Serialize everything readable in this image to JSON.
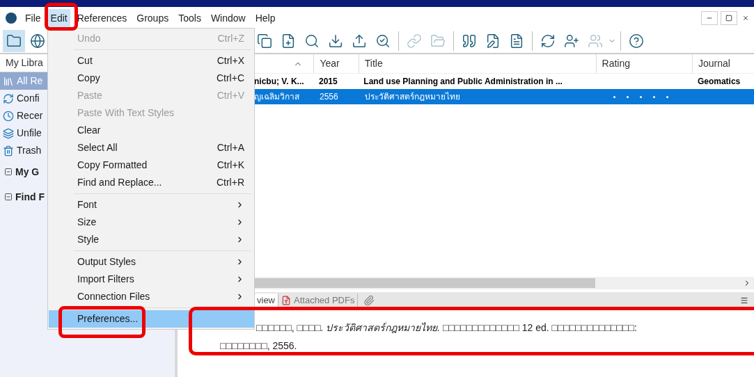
{
  "menu_bar": [
    {
      "label": "File",
      "selected": false
    },
    {
      "label": "Edit",
      "selected": true
    },
    {
      "label": "References",
      "selected": false
    },
    {
      "label": "Groups",
      "selected": false
    },
    {
      "label": "Tools",
      "selected": false
    },
    {
      "label": "Window",
      "selected": false
    },
    {
      "label": "Help",
      "selected": false
    }
  ],
  "sidebar": {
    "header": "My Libra",
    "items": [
      {
        "label": "All Re",
        "selected": true
      },
      {
        "label": "Confi",
        "selected": false
      },
      {
        "label": "Recer",
        "selected": false
      },
      {
        "label": "Unfile",
        "selected": false
      },
      {
        "label": "Trash",
        "selected": false
      }
    ],
    "groups": [
      {
        "label": "My G",
        "expanded": true
      },
      {
        "label": "Find F",
        "expanded": true
      }
    ]
  },
  "table": {
    "columns": [
      "Year",
      "Title",
      "Rating",
      "Journal"
    ],
    "rows": [
      {
        "author": "nicbu; V. K...",
        "year": "2015",
        "title": "Land use Planning and Public Administration in ...",
        "journal": "Geomatics",
        "selected": false,
        "unread": true
      },
      {
        "author": "ญเฉลิมวิกาส",
        "year": "2556",
        "title": "ประวัติศาสตร์กฎหมายไทย",
        "journal": "",
        "selected": true,
        "unread": false
      }
    ]
  },
  "preview": {
    "tabs": [
      {
        "label": "view",
        "selected": true
      },
      {
        "label": "Attached PDFs",
        "selected": false
      }
    ],
    "text": "□□□□□□, □□□□. *ประวัติศาสตร์กฎหมายไทย.* □□□□□□□□□□□□□ 12 ed. □□□□□□□□□□□□□□:",
    "text_line2": "□□□□□□□□, 2556."
  },
  "edit_menu": [
    {
      "kind": "item",
      "label": "Undo",
      "shortcut": "Ctrl+Z",
      "disabled": true,
      "selected": false
    },
    {
      "kind": "separator"
    },
    {
      "kind": "item",
      "label": "Cut",
      "shortcut": "Ctrl+X",
      "disabled": false,
      "selected": false
    },
    {
      "kind": "item",
      "label": "Copy",
      "shortcut": "Ctrl+C",
      "disabled": false,
      "selected": false
    },
    {
      "kind": "item",
      "label": "Paste",
      "shortcut": "Ctrl+V",
      "disabled": true,
      "selected": false
    },
    {
      "kind": "item",
      "label": "Paste With Text Styles",
      "disabled": true,
      "selected": false
    },
    {
      "kind": "item",
      "label": "Clear",
      "disabled": false,
      "selected": false
    },
    {
      "kind": "item",
      "label": "Select All",
      "shortcut": "Ctrl+A",
      "disabled": false,
      "selected": false
    },
    {
      "kind": "item",
      "label": "Copy Formatted",
      "shortcut": "Ctrl+K",
      "disabled": false,
      "selected": false
    },
    {
      "kind": "item",
      "label": "Find and Replace...",
      "shortcut": "Ctrl+R",
      "disabled": false,
      "selected": false
    },
    {
      "kind": "separator"
    },
    {
      "kind": "submenu",
      "label": "Font",
      "disabled": false,
      "selected": false
    },
    {
      "kind": "submenu",
      "label": "Size",
      "disabled": false,
      "selected": false
    },
    {
      "kind": "submenu",
      "label": "Style",
      "disabled": false,
      "selected": false
    },
    {
      "kind": "separator"
    },
    {
      "kind": "submenu",
      "label": "Output Styles",
      "disabled": false,
      "selected": false
    },
    {
      "kind": "submenu",
      "label": "Import Filters",
      "disabled": false,
      "selected": false
    },
    {
      "kind": "submenu",
      "label": "Connection Files",
      "disabled": false,
      "selected": false
    },
    {
      "kind": "separator"
    },
    {
      "kind": "item",
      "label": "Preferences...",
      "disabled": false,
      "selected": true
    }
  ]
}
